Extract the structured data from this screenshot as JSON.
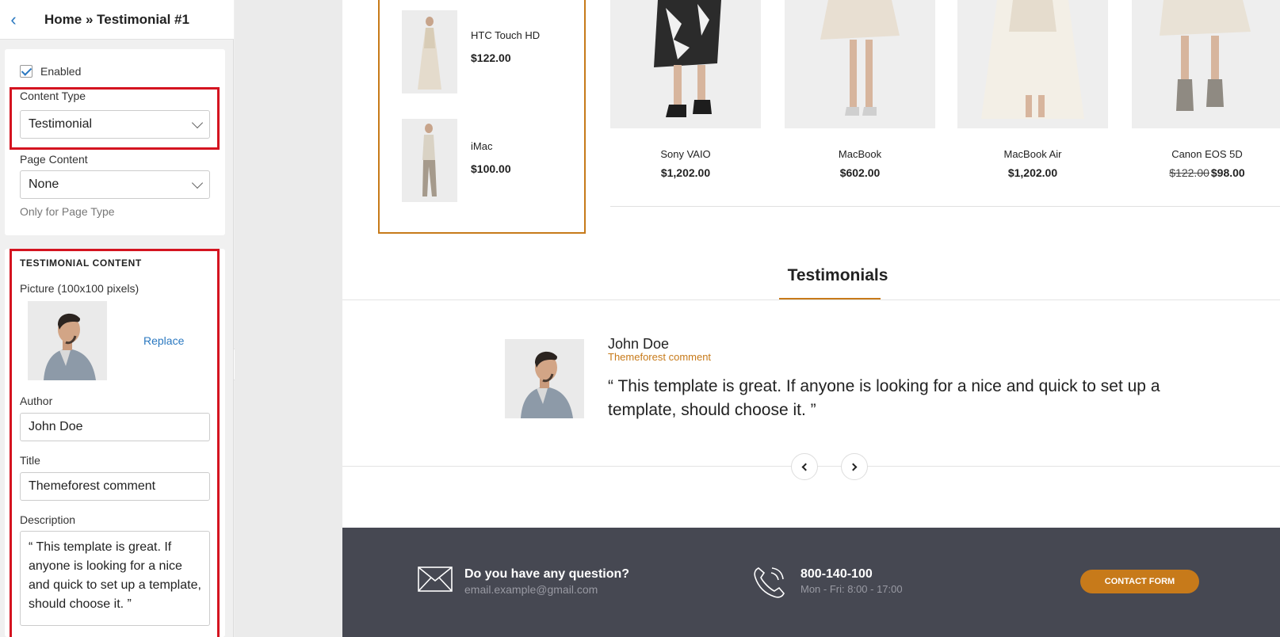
{
  "panel": {
    "breadcrumb": "Home » Testimonial #1",
    "enabled_label": "Enabled",
    "content_type": {
      "label": "Content Type",
      "value": "Testimonial"
    },
    "page_content": {
      "label": "Page Content",
      "value": "None",
      "hint": "Only for Page Type"
    },
    "testimonial": {
      "section_title": "TESTIMONIAL CONTENT",
      "picture_label": "Picture (100x100 pixels)",
      "replace_label": "Replace",
      "author_label": "Author",
      "author_value": "John Doe",
      "title_label": "Title",
      "title_value": "Themeforest comment",
      "description_label": "Description",
      "description_value": "“ This template is great. If anyone is looking for a nice and quick to set up a template, should choose it. ”"
    }
  },
  "preview": {
    "side_products": [
      {
        "name": "HTC Touch HD",
        "price": "$122.00"
      },
      {
        "name": "iMac",
        "price": "$100.00"
      }
    ],
    "products": [
      {
        "name": "Sony VAIO",
        "price": "$1,202.00",
        "old_price": ""
      },
      {
        "name": "MacBook",
        "price": "$602.00",
        "old_price": ""
      },
      {
        "name": "MacBook Air",
        "price": "$1,202.00",
        "old_price": ""
      },
      {
        "name": "Canon EOS 5D",
        "price": "$98.00",
        "old_price": "$122.00"
      }
    ],
    "testimonials_heading": "Testimonials",
    "testimonial": {
      "author": "John Doe",
      "title": "Themeforest comment",
      "quote": "“ This template is great. If anyone is looking for a nice and quick to set up a template, should choose it. ”"
    },
    "footer": {
      "question": "Do you have any question?",
      "email": "email.example@gmail.com",
      "phone": "800-140-100",
      "hours": "Mon - Fri: 8:00 - 17:00",
      "contact_button": "CONTACT FORM"
    }
  },
  "colors": {
    "accent": "#c77a1a",
    "link": "#2a78c0",
    "highlight": "#d41420",
    "footer_bg": "#464852"
  }
}
